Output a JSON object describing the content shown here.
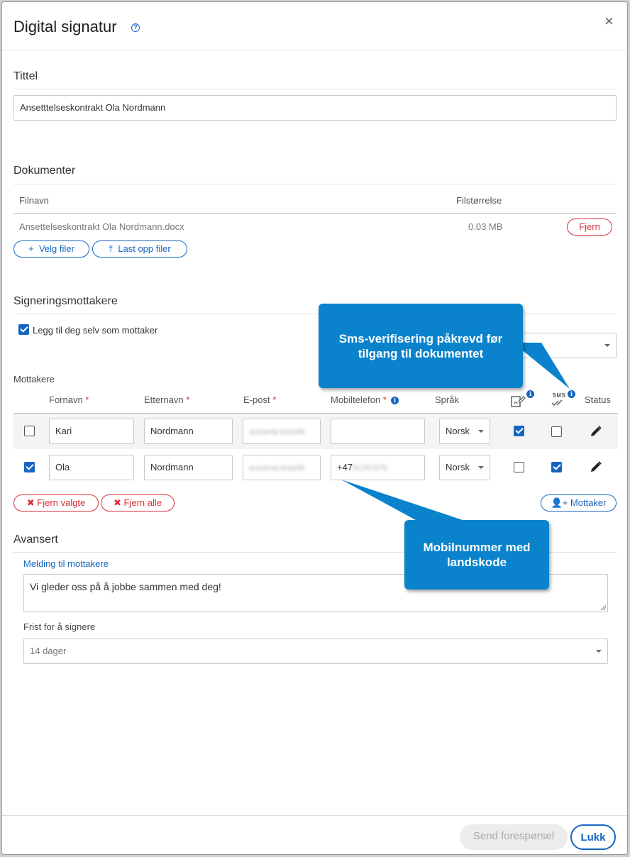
{
  "dialog": {
    "title": "Digital signatur",
    "help_icon": "?",
    "close_icon": "×"
  },
  "title_section": {
    "heading": "Tittel",
    "value": "Ansetttelseskontrakt Ola Nordmann"
  },
  "documents": {
    "heading": "Dokumenter",
    "col_filename": "Filnavn",
    "col_filesize": "Filstørrelse",
    "files": [
      {
        "name": "Ansettelseskontrakt Ola Nordmann.docx",
        "size": "0.03 MB",
        "remove_label": "Fjern"
      }
    ],
    "choose_files_label": "Velg filer",
    "upload_files_label": "Last opp filer"
  },
  "recipients_section": {
    "heading": "Signeringsmottakere",
    "add_self_label": "Legg til deg selv som mottaker",
    "add_self_checked": true,
    "recipients_label": "Mottakere",
    "columns": {
      "firstname": "Fornavn",
      "lastname": "Etternavn",
      "email": "E-post",
      "mobile": "Mobiltelefon",
      "language": "Språk",
      "status": "Status",
      "required_mark": "*",
      "sms_icon_text": "SMS"
    },
    "rows": [
      {
        "selected": false,
        "firstname": "Kari",
        "lastname": "Nordmann",
        "email": "suzanne.brachb",
        "mobile": "",
        "language": "Norsk",
        "sign": true,
        "sms": false
      },
      {
        "selected": true,
        "firstname": "Ola",
        "lastname": "Nordmann",
        "email": "suzanne.brachb",
        "mobile_prefix": "+47",
        "mobile_rest": "91767276",
        "language": "Norsk",
        "sign": false,
        "sms": true
      }
    ],
    "remove_selected_label": "Fjern valgte",
    "remove_all_label": "Fjern alle",
    "add_recipient_label": "Mottaker"
  },
  "advanced": {
    "heading": "Avansert",
    "message_label": "Melding til mottakere",
    "message_value": "Vi gleder oss på å jobbe sammen med deg!",
    "deadline_label": "Frist for å signere",
    "deadline_value": "14 dager"
  },
  "callouts": {
    "sms": "Sms-verifisering påkrevd før tilgang til dokumentet",
    "mobile": "Mobilnummer med landskode"
  },
  "footer": {
    "send_label": "Send forespørsel",
    "close_label": "Lukk"
  },
  "colors": {
    "accent": "#1565c0",
    "danger": "#d9303a",
    "callout": "#0a83cc"
  }
}
